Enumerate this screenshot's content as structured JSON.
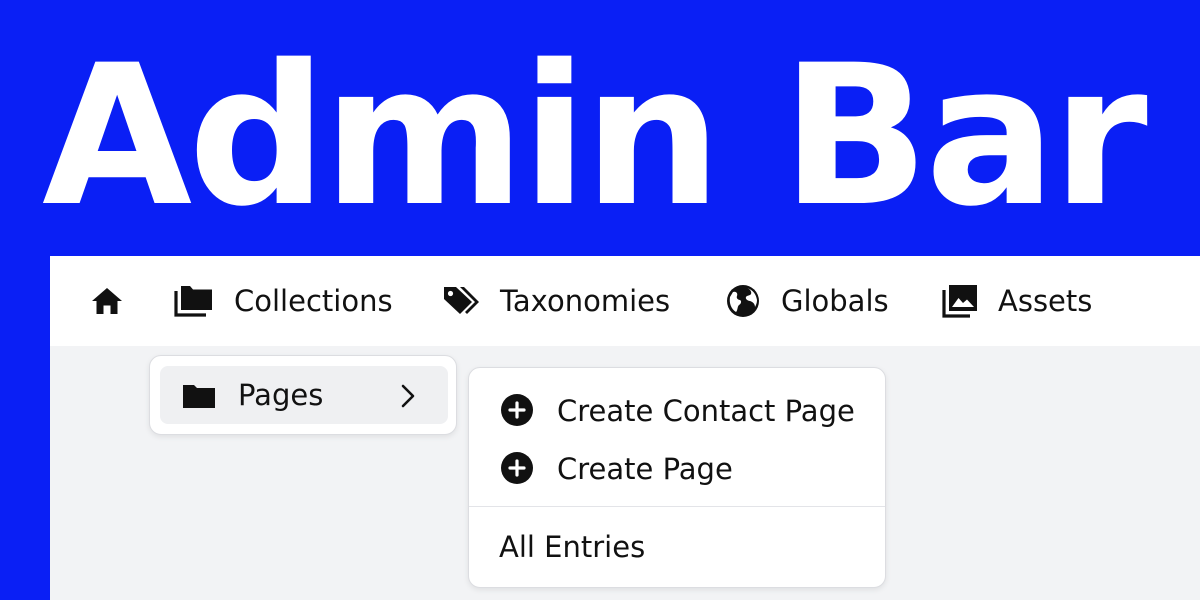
{
  "hero": {
    "title": "Admin Bar"
  },
  "admin_bar": {
    "home_icon": "home-icon",
    "items": [
      {
        "label": "Collections",
        "icon": "collections-folder-icon"
      },
      {
        "label": "Taxonomies",
        "icon": "tags-icon"
      },
      {
        "label": "Globals",
        "icon": "globe-icon"
      },
      {
        "label": "Assets",
        "icon": "images-icon"
      }
    ]
  },
  "collections_menu": {
    "items": [
      {
        "label": "Pages",
        "icon": "folder-icon",
        "submenu_icon": "chevron-right-icon"
      }
    ]
  },
  "pages_submenu": {
    "actions": [
      {
        "label": "Create Contact Page",
        "icon": "plus-circle-icon"
      },
      {
        "label": "Create Page",
        "icon": "plus-circle-icon"
      }
    ],
    "all_entries": "All Entries"
  },
  "colors": {
    "brand_blue": "#0a1ff5",
    "bar_background": "#ffffff",
    "page_background": "#f2f3f5",
    "text": "#111111"
  }
}
